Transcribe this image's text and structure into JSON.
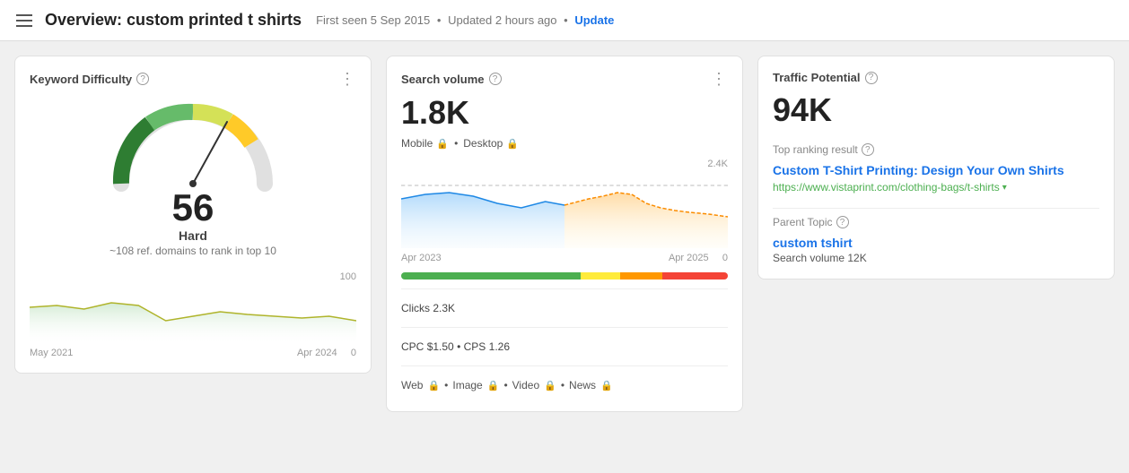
{
  "header": {
    "title": "Overview: custom printed t shirts",
    "first_seen": "First seen 5 Sep 2015",
    "updated": "Updated 2 hours ago",
    "update_label": "Update"
  },
  "card1": {
    "title": "Keyword Difficulty",
    "score": "56",
    "difficulty_label": "Hard",
    "ref_domains": "~108 ref. domains to rank in top 10",
    "chart_label_top": "100",
    "chart_label_left": "May 2021",
    "chart_label_right": "Apr 2024",
    "chart_label_right_val": "0"
  },
  "card2": {
    "title": "Search volume",
    "value": "1.8K",
    "mobile_label": "Mobile",
    "desktop_label": "Desktop",
    "chart_label_top": "2.4K",
    "chart_label_left": "Apr 2023",
    "chart_label_right": "Apr 2025",
    "chart_label_right_val": "0",
    "clicks_label": "Clicks",
    "clicks_value": "2.3K",
    "cpc_label": "CPC",
    "cpc_value": "$1.50",
    "cps_label": "CPS",
    "cps_value": "1.26",
    "web_label": "Web",
    "image_label": "Image",
    "video_label": "Video",
    "news_label": "News"
  },
  "card3": {
    "title": "Traffic Potential",
    "value": "94K",
    "top_ranking_label": "Top ranking result",
    "result_title": "Custom T-Shirt Printing: Design Your Own Shirts",
    "result_url": "https://www.vistaprint.com/clothing-bags/t-shirts",
    "parent_topic_label": "Parent Topic",
    "parent_topic_title": "custom tshirt",
    "parent_topic_search_vol": "Search volume 12K"
  }
}
